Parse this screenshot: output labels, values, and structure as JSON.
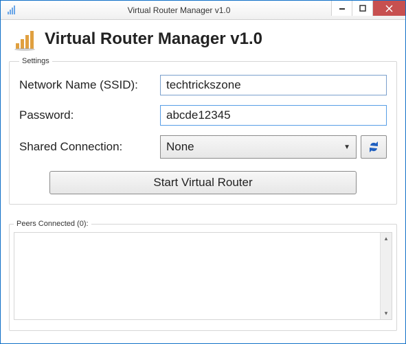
{
  "window": {
    "title": "Virtual Router Manager v1.0"
  },
  "header": {
    "title": "Virtual Router Manager v1.0"
  },
  "settings": {
    "legend": "Settings",
    "ssid_label": "Network Name (SSID):",
    "ssid_value": "techtrickszone",
    "password_label": "Password:",
    "password_value": "abcde12345",
    "shared_label": "Shared Connection:",
    "shared_value": "None"
  },
  "actions": {
    "start_label": "Start Virtual Router"
  },
  "peers": {
    "legend": "Peers Connected (0):"
  }
}
